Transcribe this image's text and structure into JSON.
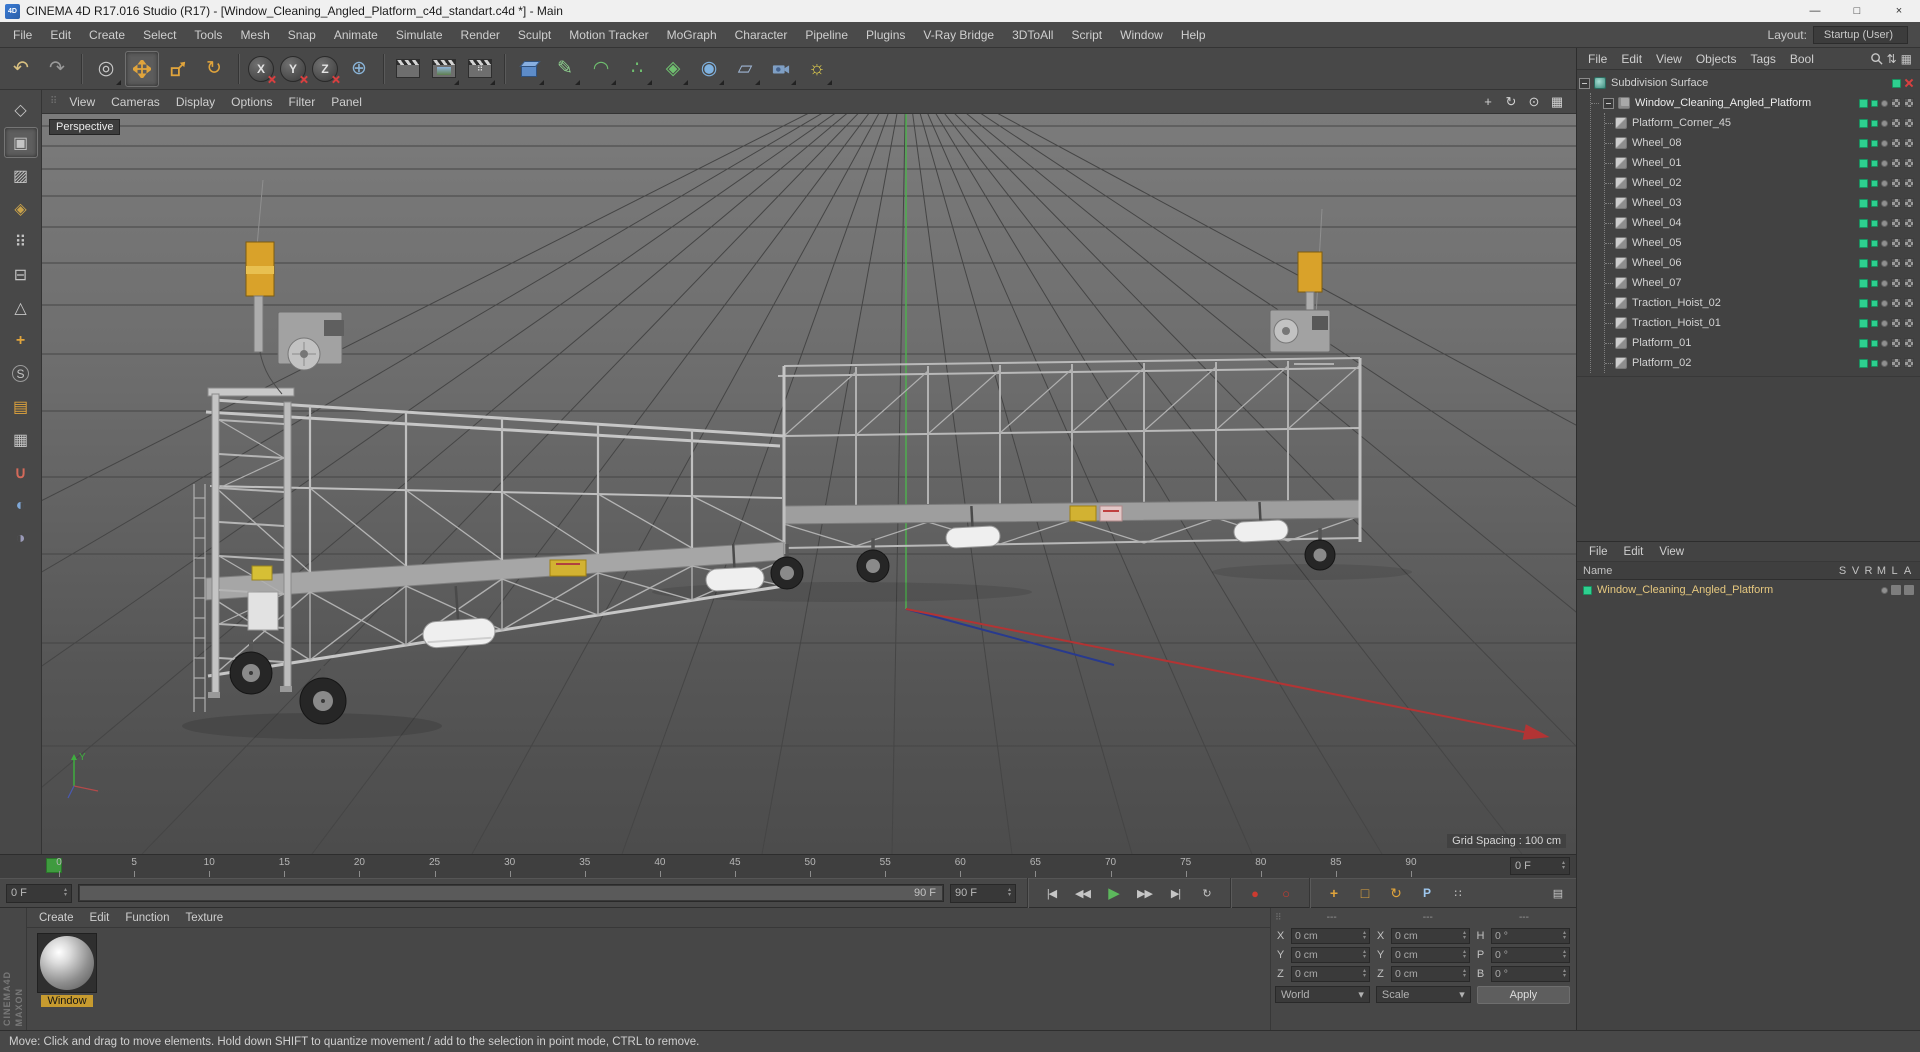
{
  "window": {
    "title": "CINEMA 4D R17.016 Studio (R17) - [Window_Cleaning_Angled_Platform_c4d_standart.c4d *] - Main"
  },
  "icons": {
    "app": "4D",
    "minimize": "—",
    "maximize": "□",
    "close": "×",
    "undo": "↶",
    "redo": "↷",
    "live_selection": "◎",
    "rotate_tool": "↻",
    "coordinate_system": "⊕",
    "spline_pen": "✎",
    "bend": "◠",
    "cloner": "∴",
    "simulation": "◈",
    "subdivision": "◉",
    "floor": "▱",
    "light": "☼",
    "pan_view": "+",
    "orbit_view": "↻",
    "zoom_view": "⊙",
    "toggle_view": "▦",
    "sort": "⇅",
    "panel_grid": "▦",
    "goto_start": "|◀",
    "prev_key": "◀◀",
    "prev_frame": "◀",
    "play": "▶",
    "next_frame": "▶",
    "next_key": "▶▶",
    "goto_end": "▶|",
    "loop": "↻",
    "record": "●",
    "autokey": "○",
    "pla": "∷",
    "parameter": "P",
    "timeline_panel": "▤",
    "make_editable": "◇",
    "model_mode": "▣",
    "texture_mode": "▨",
    "workplane_mode": "◈",
    "points_mode": "⠿",
    "edges_mode": "⊟",
    "polygons_mode": "△",
    "axis_mode": "+",
    "viewport_solo": "S",
    "paint_tool": "▤",
    "uv_tool": "▦",
    "snap_tool": "∪",
    "python_1": "◐",
    "python_2": "◑",
    "grip": "⠿",
    "spin_up": "▴",
    "spin_down": "▾",
    "dropdown": "▾"
  },
  "menubar": {
    "items": [
      "File",
      "Edit",
      "Create",
      "Select",
      "Tools",
      "Mesh",
      "Snap",
      "Animate",
      "Simulate",
      "Render",
      "Sculpt",
      "Motion Tracker",
      "MoGraph",
      "Character",
      "Pipeline",
      "Plugins",
      "V-Ray Bridge",
      "3DToAll",
      "Script",
      "Window",
      "Help"
    ],
    "layout_label": "Layout:",
    "layout_value": "Startup (User)"
  },
  "toolbar": {
    "axis": [
      "X",
      "Y",
      "Z"
    ]
  },
  "viewport": {
    "menu": [
      "View",
      "Cameras",
      "Display",
      "Options",
      "Filter",
      "Panel"
    ],
    "camera_label": "Perspective",
    "grid_label": "Grid Spacing : 100 cm",
    "axis_y_label": "Y"
  },
  "object_manager": {
    "menu": [
      "File",
      "Edit",
      "View",
      "Objects",
      "Tags",
      "Bool"
    ],
    "tree": [
      "Subdivision Surface",
      "Window_Cleaning_Angled_Platform",
      "Platform_Corner_45",
      "Wheel_08",
      "Wheel_01",
      "Wheel_02",
      "Wheel_03",
      "Wheel_04",
      "Wheel_05",
      "Wheel_06",
      "Wheel_07",
      "Traction_Hoist_02",
      "Traction_Hoist_01",
      "Platform_01",
      "Platform_02"
    ]
  },
  "layer_manager": {
    "menu": [
      "File",
      "Edit",
      "View"
    ],
    "name_header": "Name",
    "columns": [
      "S",
      "V",
      "R",
      "M",
      "L",
      "A"
    ],
    "rows": [
      {
        "name": "Window_Cleaning_Angled_Platform"
      }
    ]
  },
  "timeline": {
    "ticks": [
      "0",
      "5",
      "10",
      "15",
      "20",
      "25",
      "30",
      "35",
      "40",
      "45",
      "50",
      "55",
      "60",
      "65",
      "70",
      "75",
      "80",
      "85",
      "90"
    ],
    "current_frame": "0 F",
    "start": "0 F",
    "end": "90 F",
    "range_end_label": "90 F"
  },
  "materials": {
    "menu": [
      "Create",
      "Edit",
      "Function",
      "Texture"
    ],
    "items": [
      {
        "label": "Window"
      }
    ]
  },
  "coordinates": {
    "headers": [
      "---",
      "---",
      "---"
    ],
    "rows": [
      {
        "l1": "X",
        "v1": "0 cm",
        "l2": "X",
        "v2": "0 cm",
        "l3": "H",
        "v3": "0 °"
      },
      {
        "l1": "Y",
        "v1": "0 cm",
        "l2": "Y",
        "v2": "0 cm",
        "l3": "P",
        "v3": "0 °"
      },
      {
        "l1": "Z",
        "v1": "0 cm",
        "l2": "Z",
        "v2": "0 cm",
        "l3": "B",
        "v3": "0 °"
      }
    ],
    "space": "World",
    "mode": "Scale",
    "apply": "Apply"
  },
  "statusbar": {
    "text": "Move: Click and drag to move elements. Hold down SHIFT to quantize movement / add to the selection in point mode, CTRL to remove."
  },
  "brand": {
    "line1": "MAXON",
    "line2": "CINEMA4D"
  },
  "colors": {
    "accent_orange": "#e0a43c",
    "enable_green": "#2ecf8f",
    "highlight_yellow": "#c79b2f",
    "play_green": "#5cb85c",
    "record_red": "#c0392b",
    "axis_red": "#b23434",
    "axis_green": "#4fae4f",
    "axis_blue": "#283a8e"
  }
}
